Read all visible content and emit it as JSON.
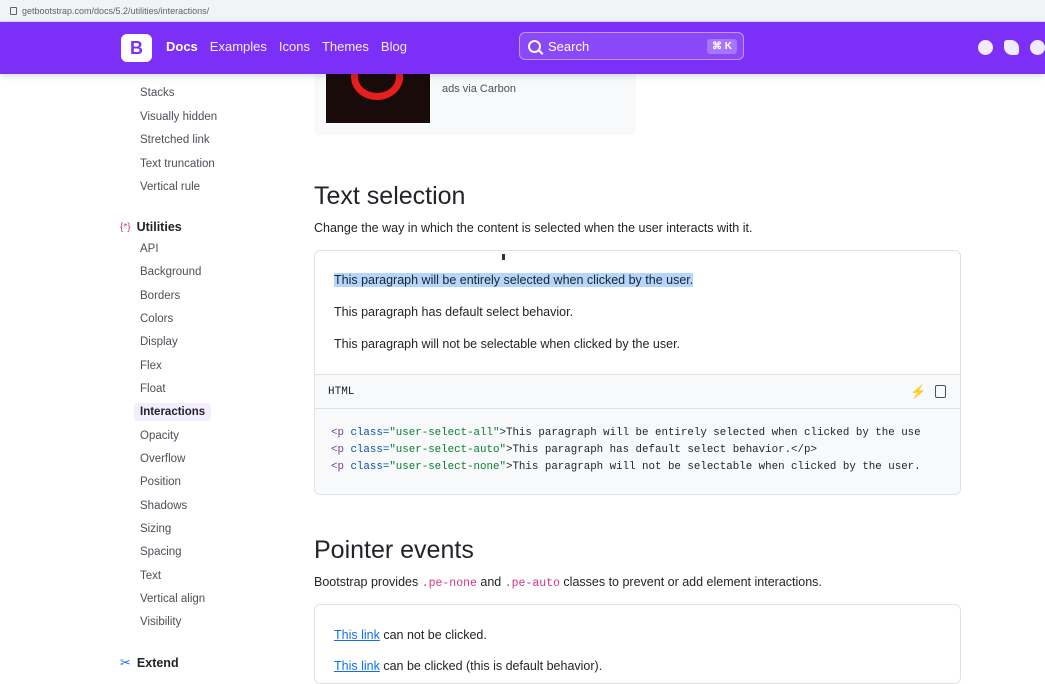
{
  "browser": {
    "url": "getbootstrap.com/docs/5.2/utilities/interactions/"
  },
  "navbar": {
    "brand": "B",
    "links": [
      "Docs",
      "Examples",
      "Icons",
      "Themes",
      "Blog"
    ],
    "search_label": "Search",
    "search_shortcut": "⌘ K",
    "socials": [
      "github-icon",
      "twitter-icon",
      "slack-icon"
    ]
  },
  "sidebar": {
    "helpers_tail": [
      "Stacks",
      "Visually hidden",
      "Stretched link",
      "Text truncation",
      "Vertical rule"
    ],
    "utilities_heading": "Utilities",
    "utilities_icon": "{*}",
    "utilities_items": [
      "API",
      "Background",
      "Borders",
      "Colors",
      "Display",
      "Flex",
      "Float",
      "Interactions",
      "Opacity",
      "Overflow",
      "Position",
      "Shadows",
      "Sizing",
      "Spacing",
      "Text",
      "Vertical align",
      "Visibility"
    ],
    "active_item": "Interactions",
    "extend_heading": "Extend"
  },
  "ad": {
    "caption": "ads via Carbon"
  },
  "text_selection": {
    "title": "Text selection",
    "lead": "Change the way in which the content is selected when the user interacts with it.",
    "p_all": "This paragraph will be entirely selected when clicked by the user.",
    "p_auto": "This paragraph has default select behavior.",
    "p_none": "This paragraph will not be selectable when clicked by the user.",
    "code_lang": "HTML",
    "code": [
      {
        "open": "<p",
        "attr": " class=",
        "val": "\"user-select-all\"",
        "rest": ">This paragraph will be entirely selected when clicked by the use"
      },
      {
        "open": "<p",
        "attr": " class=",
        "val": "\"user-select-auto\"",
        "rest": ">This paragraph has default select behavior.</p>"
      },
      {
        "open": "<p",
        "attr": " class=",
        "val": "\"user-select-none\"",
        "rest": ">This paragraph will not be selectable when clicked by the user."
      }
    ]
  },
  "pointer_events": {
    "title": "Pointer events",
    "lead_before": "Bootstrap provides ",
    "code_1": ".pe-none",
    "lead_mid": " and ",
    "code_2": ".pe-auto",
    "lead_after": " classes to prevent or add element interactions.",
    "link_text": "This link",
    "line_1_rest": " can not be clicked.",
    "line_2_rest": " can be clicked (this is default behavior)."
  }
}
